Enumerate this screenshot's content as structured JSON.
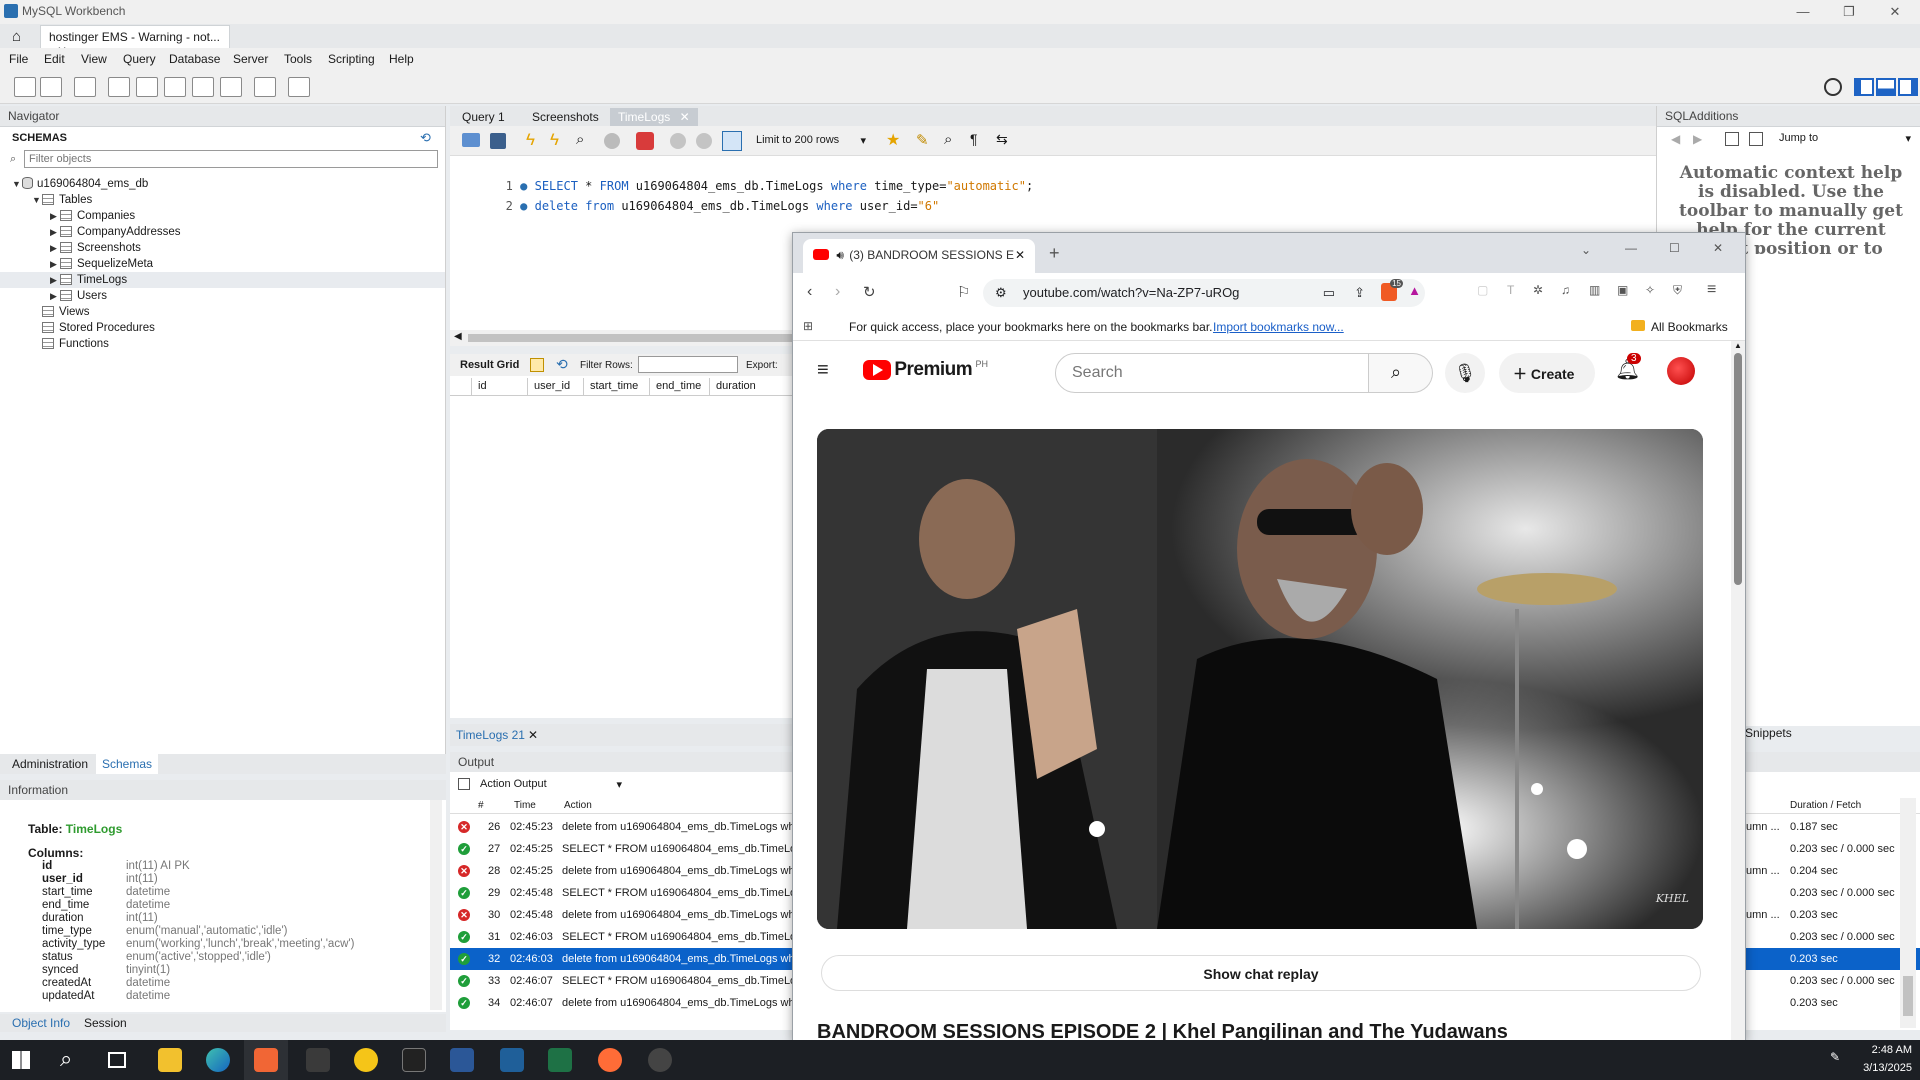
{
  "window": {
    "app_title": "MySQL Workbench",
    "connection_tab": "hostinger EMS - Warning - not..."
  },
  "menu": [
    "File",
    "Edit",
    "View",
    "Query",
    "Database",
    "Server",
    "Tools",
    "Scripting",
    "Help"
  ],
  "navigator": {
    "header": "Navigator",
    "schemas_label": "SCHEMAS",
    "filter_placeholder": "Filter objects",
    "database": "u169064804_ems_db",
    "tables_label": "Tables",
    "tables": [
      "Companies",
      "CompanyAddresses",
      "Screenshots",
      "SequelizeMeta",
      "TimeLogs",
      "Users"
    ],
    "views_label": "Views",
    "procedures_label": "Stored Procedures",
    "functions_label": "Functions"
  },
  "bottom_tabs": {
    "admin": "Administration",
    "schemas": "Schemas"
  },
  "info": {
    "header": "Information",
    "table_prefix": "Table:",
    "table_name": "TimeLogs",
    "columns_label": "Columns:",
    "columns": [
      {
        "name": "id",
        "type": "int(11) AI PK",
        "bold": true
      },
      {
        "name": "user_id",
        "type": "int(11)",
        "bold": true
      },
      {
        "name": "start_time",
        "type": "datetime"
      },
      {
        "name": "end_time",
        "type": "datetime"
      },
      {
        "name": "duration",
        "type": "int(11)"
      },
      {
        "name": "time_type",
        "type": "enum('manual','automatic','idle')"
      },
      {
        "name": "activity_type",
        "type": "enum('working','lunch','break','meeting','acw')"
      },
      {
        "name": "status",
        "type": "enum('active','stopped','idle')"
      },
      {
        "name": "synced",
        "type": "tinyint(1)"
      },
      {
        "name": "createdAt",
        "type": "datetime"
      },
      {
        "name": "updatedAt",
        "type": "datetime"
      }
    ],
    "tab_object_info": "Object Info",
    "tab_session": "Session"
  },
  "editor": {
    "tabs": [
      "Query 1",
      "Screenshots",
      "TimeLogs"
    ],
    "limit_label": "Limit to 200 rows",
    "lines": [
      {
        "n": "1",
        "k1": "SELECT",
        "t1": " * ",
        "k2": "FROM",
        "t2": " u169064804_ems_db.TimeLogs ",
        "k3": "where",
        "t3": " time_type=",
        "s": "\"automatic\"",
        "t4": ";"
      },
      {
        "n": "2",
        "k1": "delete",
        "t1": " ",
        "k2": "from",
        "t2": " u169064804_ems_db.TimeLogs ",
        "k3": "where",
        "t3": " user_id=",
        "s": "\"6\"",
        "t4": ""
      }
    ]
  },
  "result": {
    "grid_label": "Result Grid",
    "filter_label": "Filter Rows:",
    "export_label": "Export:",
    "columns": [
      "id",
      "user_id",
      "start_time",
      "end_time",
      "duration"
    ],
    "tab": "TimeLogs 21"
  },
  "output": {
    "header": "Output",
    "mode": "Action Output",
    "col_hash": "#",
    "col_time": "Time",
    "col_action": "Action",
    "col_duration": "Duration / Fetch",
    "rows": [
      {
        "status": "err",
        "n": "26",
        "time": "02:45:23",
        "action": "delete from u169064804_ems_db.TimeLogs whe",
        "msg": "umn ...",
        "dur": "0.187 sec"
      },
      {
        "status": "ok",
        "n": "27",
        "time": "02:45:25",
        "action": "SELECT * FROM u169064804_ems_db.TimeLog",
        "msg": "",
        "dur": "0.203 sec / 0.000 sec"
      },
      {
        "status": "err",
        "n": "28",
        "time": "02:45:25",
        "action": "delete from u169064804_ems_db.TimeLogs whe",
        "msg": "umn ...",
        "dur": "0.204 sec"
      },
      {
        "status": "ok",
        "n": "29",
        "time": "02:45:48",
        "action": "SELECT * FROM u169064804_ems_db.TimeLog",
        "msg": "",
        "dur": "0.203 sec / 0.000 sec"
      },
      {
        "status": "err",
        "n": "30",
        "time": "02:45:48",
        "action": "delete from u169064804_ems_db.TimeLogs whe",
        "msg": "umn ...",
        "dur": "0.203 sec"
      },
      {
        "status": "ok",
        "n": "31",
        "time": "02:46:03",
        "action": "SELECT * FROM u169064804_ems_db.TimeLog",
        "msg": "",
        "dur": "0.203 sec / 0.000 sec"
      },
      {
        "status": "ok",
        "n": "32",
        "time": "02:46:03",
        "action": "delete from u169064804_ems_db.TimeLogs whe",
        "msg": "",
        "dur": "0.203 sec",
        "selected": true
      },
      {
        "status": "ok",
        "n": "33",
        "time": "02:46:07",
        "action": "SELECT * FROM u169064804_ems_db.TimeLog",
        "msg": "",
        "dur": "0.203 sec / 0.000 sec"
      },
      {
        "status": "ok",
        "n": "34",
        "time": "02:46:07",
        "action": "delete from u169064804_ems_db.TimeLogs whe",
        "msg": "",
        "dur": "0.203 sec"
      }
    ]
  },
  "sqladditions": {
    "header": "SQLAdditions",
    "jump_to": "Jump to",
    "help_text": "Automatic context help is disabled. Use the toolbar to manually get help for the current caret position or to automatic help.",
    "snippets": "Snippets"
  },
  "browser": {
    "tab_title": "(3) BANDROOM SESSIONS E",
    "url": "youtube.com/watch?v=Na-ZP7-uROg",
    "brave_badge": "15",
    "bookmarks_text": "For quick access, place your bookmarks here on the bookmarks bar.",
    "import_link": "Import bookmarks now...",
    "all_bookmarks": "All Bookmarks",
    "yt_brand": "Premium",
    "yt_region": "PH",
    "search_placeholder": "Search",
    "create_label": "Create",
    "notif_count": "3",
    "chat_replay": "Show chat replay",
    "video_title": "BANDROOM SESSIONS EPISODE 2 | Khel Pangilinan and The Yudawans",
    "watermark": "KHEL"
  },
  "taskbar": {
    "time": "2:48 AM",
    "date": "3/13/2025"
  }
}
